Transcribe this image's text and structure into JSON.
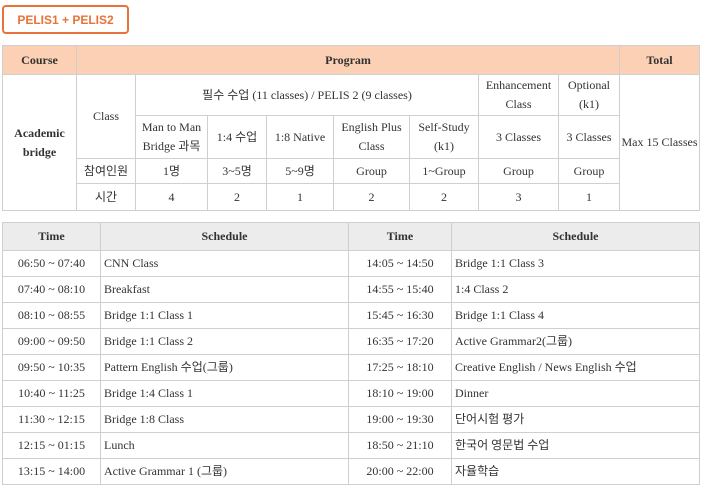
{
  "tab": {
    "label": "PELIS1 + PELIS2"
  },
  "program": {
    "headers": {
      "course": "Course",
      "program": "Program",
      "total": "Total"
    },
    "course": "Academic bridge",
    "class_label": "Class",
    "required_group": "필수 수업 (11 classes) / PELIS 2 (9 classes)",
    "enhancement": "Enhancement Class",
    "optional": "Optional (k1)",
    "total": "Max 15 Classes",
    "subjects": [
      "Man to Man Bridge 과목",
      "1:4 수업",
      "1:8 Native",
      "English Plus Class",
      "Self-Study (k1)",
      "3 Classes",
      "3 Classes"
    ],
    "participants_label": "참여인원",
    "participants": [
      "1명",
      "3~5명",
      "5~9명",
      "Group",
      "1~Group",
      "Group",
      "Group"
    ],
    "hours_label": "시간",
    "hours": [
      "4",
      "2",
      "1",
      "2",
      "2",
      "3",
      "1"
    ]
  },
  "schedule": {
    "headers": {
      "time": "Time",
      "schedule": "Schedule"
    },
    "rows": [
      {
        "t1": "06:50 ~ 07:40",
        "s1": "CNN Class",
        "t2": "14:05 ~ 14:50",
        "s2": "Bridge 1:1 Class 3"
      },
      {
        "t1": "07:40 ~ 08:10",
        "s1": "Breakfast",
        "t2": "14:55 ~ 15:40",
        "s2": "1:4 Class 2"
      },
      {
        "t1": "08:10 ~ 08:55",
        "s1": "Bridge 1:1 Class 1",
        "t2": "15:45 ~ 16:30",
        "s2": "Bridge 1:1 Class 4"
      },
      {
        "t1": "09:00 ~ 09:50",
        "s1": "Bridge 1:1 Class 2",
        "t2": "16:35 ~ 17:20",
        "s2": "Active Grammar2(그룹)"
      },
      {
        "t1": "09:50 ~ 10:35",
        "s1": "Pattern English 수업(그룹)",
        "t2": "17:25 ~ 18:10",
        "s2": "Creative English / News English 수업"
      },
      {
        "t1": "10:40 ~ 11:25",
        "s1": "Bridge 1:4 Class 1",
        "t2": "18:10 ~ 19:00",
        "s2": "Dinner"
      },
      {
        "t1": "11:30 ~ 12:15",
        "s1": "Bridge 1:8 Class",
        "t2": "19:00 ~ 19:30",
        "s2": "단어시험 평가"
      },
      {
        "t1": "12:15 ~ 01:15",
        "s1": "Lunch",
        "t2": "18:50 ~ 21:10",
        "s2": "한국어 영문법 수업"
      },
      {
        "t1": "13:15 ~ 14:00",
        "s1": "Active Grammar 1 (그룹)",
        "t2": "20:00 ~ 22:00",
        "s2": "자율학습"
      }
    ]
  }
}
